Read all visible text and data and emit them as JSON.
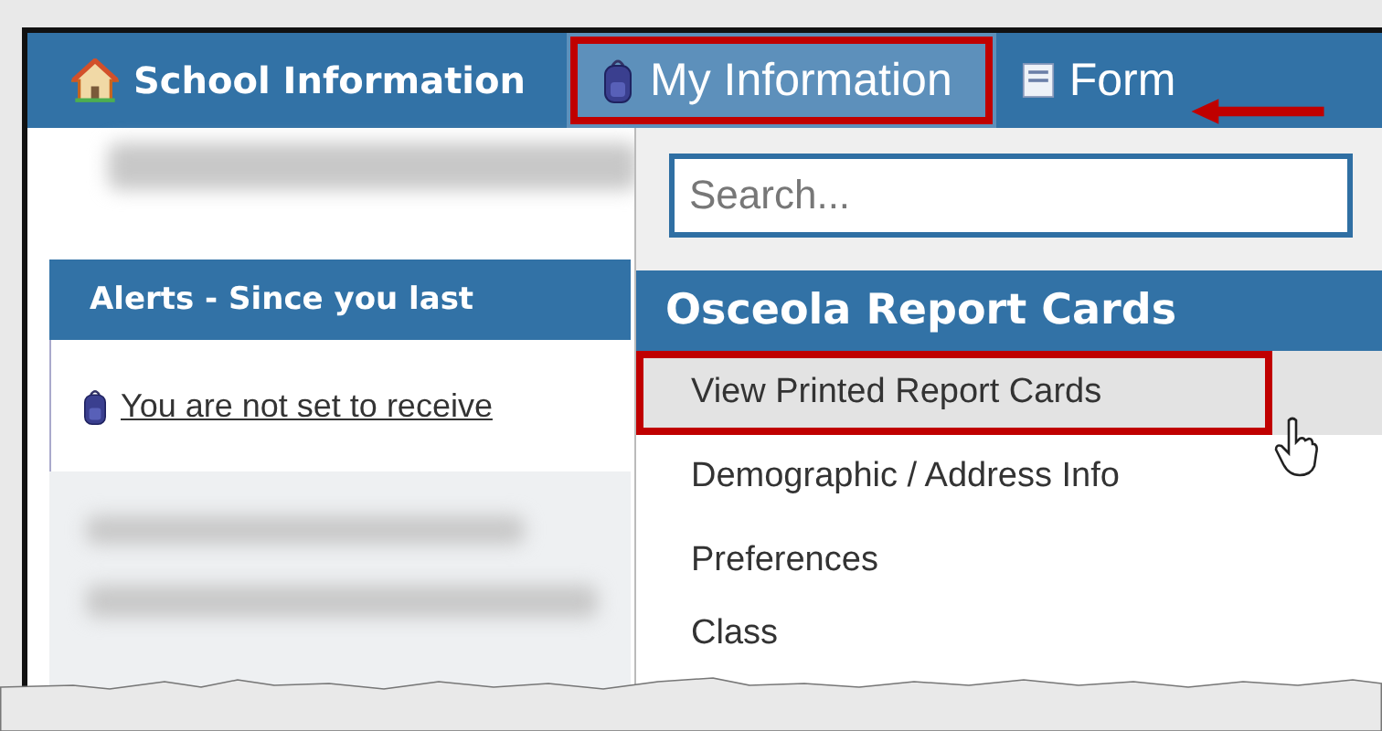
{
  "nav_tabs": [
    {
      "label": "School Information",
      "kind": "house",
      "selected": false
    },
    {
      "label": "My Information",
      "kind": "backpack",
      "selected": true
    },
    {
      "label": "Form",
      "kind": "form",
      "selected": false
    }
  ],
  "alerts": {
    "title": "Alerts - Since you last",
    "link": "You are not set to receive"
  },
  "dropdown": {
    "search": {
      "placeholder": "Search..."
    },
    "section_title": "Osceola Report Cards",
    "items": [
      {
        "label": "View Printed Report Cards",
        "selected": true
      },
      {
        "label": "Demographic / Address Info",
        "selected": false
      },
      {
        "label": "Preferences",
        "selected": false
      },
      {
        "label": "Class",
        "selected": false
      }
    ]
  }
}
